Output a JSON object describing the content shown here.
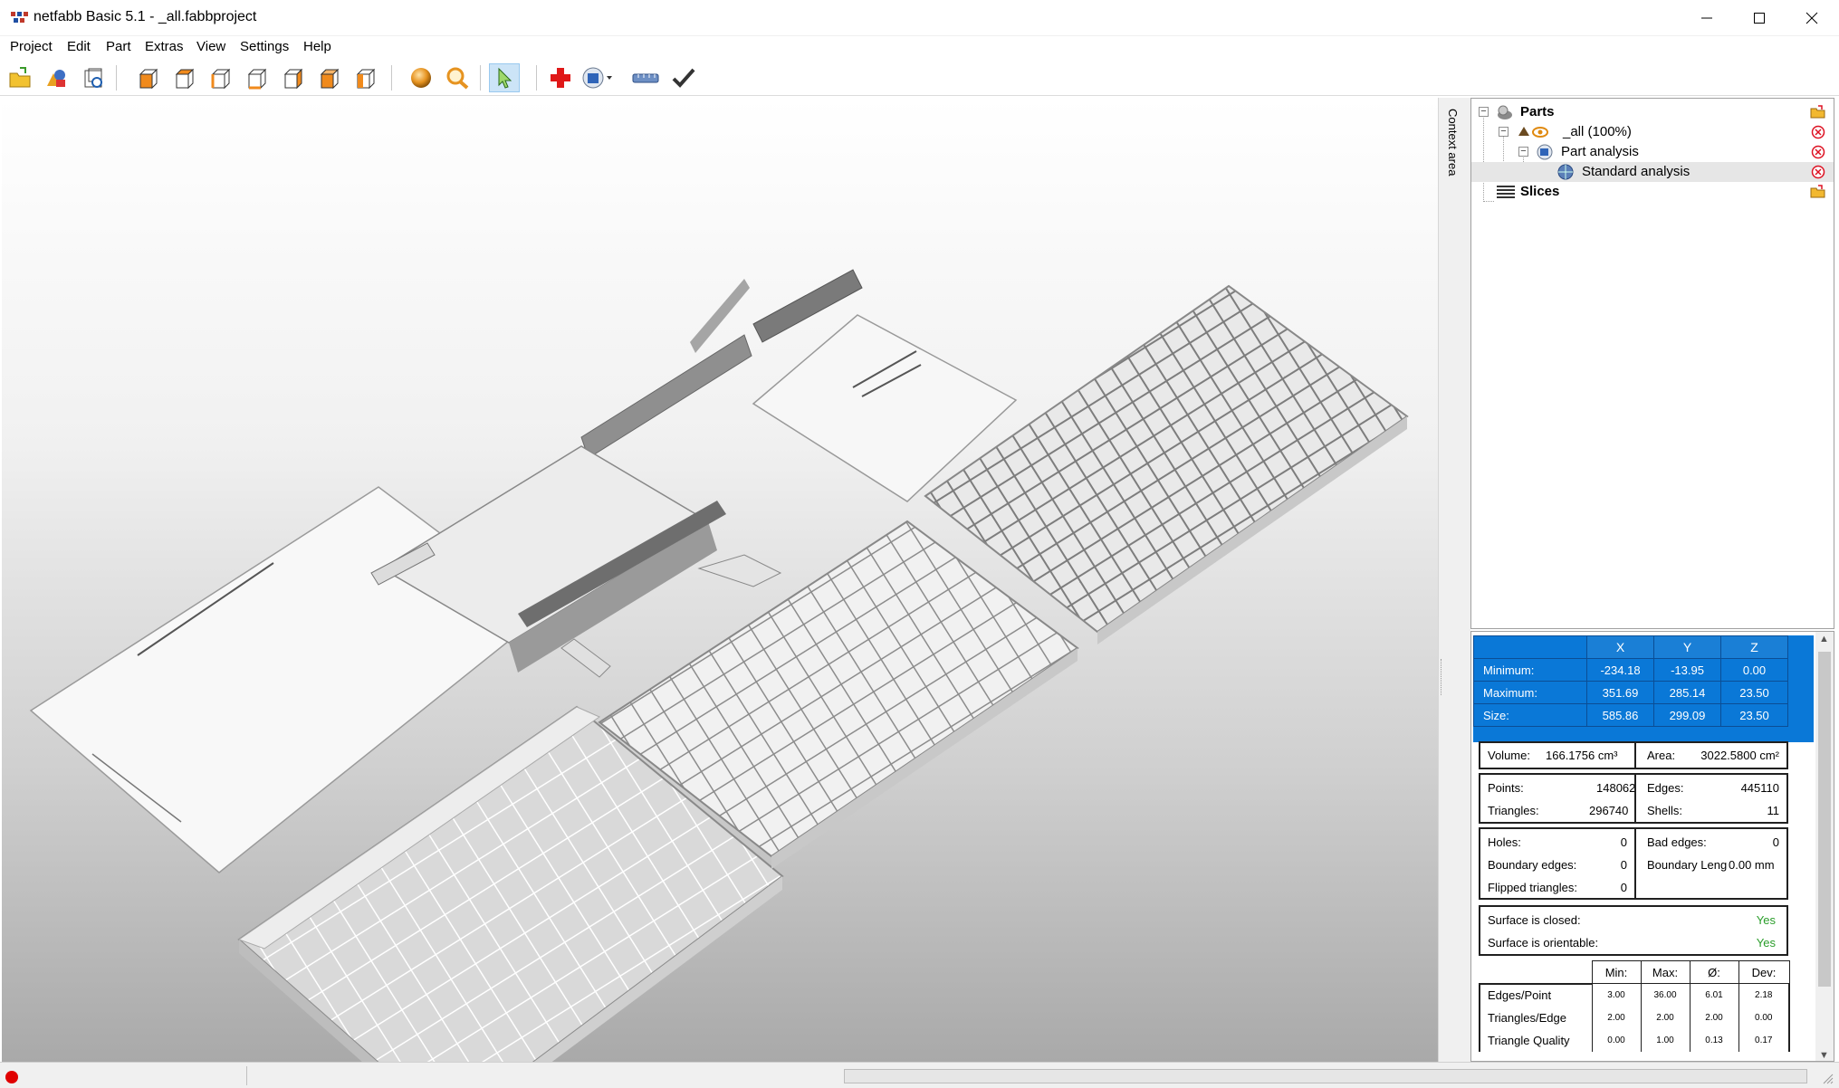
{
  "window": {
    "title": "netfabb Basic 5.1 - _all.fabbproject"
  },
  "menu": [
    "Project",
    "Edit",
    "Part",
    "Extras",
    "View",
    "Settings",
    "Help"
  ],
  "toolbar": {
    "icons": [
      "open-project-icon",
      "add-part-icon",
      "snapshot-icon",
      "view-front-icon",
      "view-back-icon",
      "view-left-icon",
      "view-right-icon",
      "view-top-icon",
      "view-bottom-icon",
      "view-iso-icon",
      "shading-sphere-icon",
      "zoom-icon",
      "select-arrow-icon",
      "repair-cross-icon",
      "analysis-icon",
      "measure-ruler-icon",
      "apply-check-icon"
    ]
  },
  "context_area": {
    "label": "Context area"
  },
  "tree": {
    "parts": "Parts",
    "all": "_all (100%)",
    "part_analysis": "Part analysis",
    "standard_analysis": "Standard analysis",
    "slices": "Slices"
  },
  "bbox": {
    "headers": [
      "X",
      "Y",
      "Z"
    ],
    "rows": [
      {
        "label": "Minimum:",
        "x": "-234.18",
        "y": "-13.95",
        "z": "0.00"
      },
      {
        "label": "Maximum:",
        "x": "351.69",
        "y": "285.14",
        "z": "23.50"
      },
      {
        "label": "Size:",
        "x": "585.86",
        "y": "299.09",
        "z": "23.50"
      }
    ]
  },
  "volume": {
    "label": "Volume:",
    "value": "166.1756 cm³",
    "area_label": "Area:",
    "area_value": "3022.5800 cm²"
  },
  "mesh": {
    "points_label": "Points:",
    "points": "148062",
    "edges_label": "Edges:",
    "edges": "445110",
    "triangles_label": "Triangles:",
    "triangles": "296740",
    "shells_label": "Shells:",
    "shells": "11"
  },
  "errors": {
    "holes_label": "Holes:",
    "holes": "0",
    "bad_edges_label": "Bad edges:",
    "bad_edges": "0",
    "boundary_edges_label": "Boundary edges:",
    "boundary_edges": "0",
    "boundary_len_label": "Boundary Leng",
    "boundary_len": "0.00 mm",
    "flipped_label": "Flipped triangles:",
    "flipped": "0"
  },
  "surface": {
    "closed_label": "Surface is closed:",
    "closed": "Yes",
    "orientable_label": "Surface is orientable:",
    "orientable": "Yes"
  },
  "stats": {
    "headers": [
      "Min:",
      "Max:",
      "Ø:",
      "Dev:"
    ],
    "rows": [
      {
        "label": "Edges/Point",
        "min": "3.00",
        "max": "36.00",
        "avg": "6.01",
        "dev": "2.18"
      },
      {
        "label": "Triangles/Edge",
        "min": "2.00",
        "max": "2.00",
        "avg": "2.00",
        "dev": "0.00"
      },
      {
        "label": "Triangle Quality",
        "min": "0.00",
        "max": "1.00",
        "avg": "0.13",
        "dev": "0.17"
      }
    ]
  },
  "colors": {
    "selection_blue": "#0a78d7",
    "yes_green": "#2a9d2a",
    "status_red": "#e00000"
  }
}
